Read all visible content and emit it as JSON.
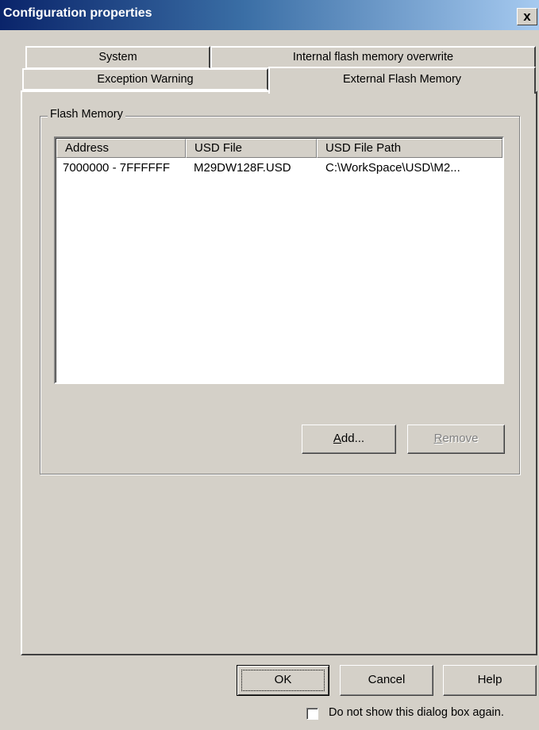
{
  "window": {
    "title": "Configuration properties",
    "close_glyph": "x"
  },
  "tabs": {
    "row1": [
      {
        "label": "System"
      },
      {
        "label": "Internal flash memory overwrite"
      }
    ],
    "row2": [
      {
        "label": "Exception Warning"
      },
      {
        "label": "External Flash Memory",
        "selected": true
      }
    ]
  },
  "flash_memory": {
    "group_label": "Flash Memory",
    "columns": [
      "Address",
      "USD File",
      "USD File Path"
    ],
    "rows": [
      {
        "address": "7000000 - 7FFFFFF",
        "usd_file": "M29DW128F.USD",
        "usd_file_path": "C:\\WorkSpace\\USD\\M2..."
      }
    ],
    "add_button": {
      "mnemonic": "A",
      "rest": "dd..."
    },
    "remove_button": {
      "mnemonic": "R",
      "rest": "emove",
      "enabled": false
    }
  },
  "footer": {
    "ok_label": "OK",
    "cancel_label": "Cancel",
    "help_label": "Help",
    "dont_show_label": "Do not show this dialog box again.",
    "dont_show_checked": false
  },
  "colors": {
    "face": "#d4d0c8",
    "title_start": "#0a246a",
    "title_end": "#a6caf0"
  }
}
